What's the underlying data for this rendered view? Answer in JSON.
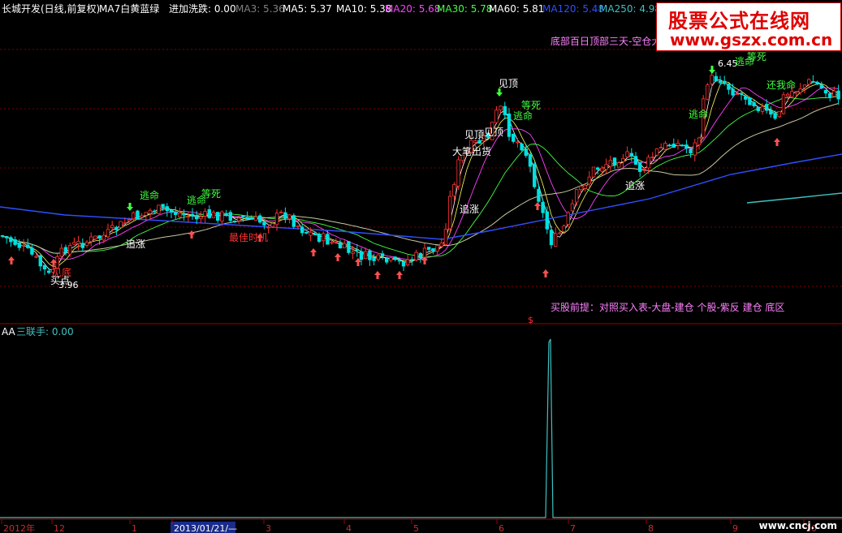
{
  "header": {
    "stock": "长城开发(日线,前复权)",
    "ma7_label": "MA7白黄蓝绿",
    "indicator_label": "进加洗跌: 0.00",
    "mas": [
      {
        "label": "MA3: 5.36",
        "color": "#808080"
      },
      {
        "label": "MA5: 5.37",
        "color": "#ffffff"
      },
      {
        "label": "MA10: 5.38",
        "color": "#ffffff"
      },
      {
        "label": "MA20: 5.68",
        "color": "#ff40ff"
      },
      {
        "label": "MA30: 5.78",
        "color": "#40ff40"
      },
      {
        "label": "MA60: 5.81",
        "color": "#ffffff"
      },
      {
        "label": "MA120: 5.48",
        "color": "#2f4fff"
      },
      {
        "label": "MA250: 4.98",
        "color": "#40c0c0"
      }
    ]
  },
  "annotations": {
    "top_right": "底部百日顶部三天-空仓大",
    "buy_hint": "买股前提：对照买入表-大盘-建仓  个股-紫反 建仓 底区",
    "low_price": "3.96",
    "high_price": "6.45",
    "signals": [
      {
        "text": "逃命",
        "color": "#40ff40",
        "pos": "a"
      },
      {
        "text": "逃命",
        "color": "#40ff40",
        "pos": "b"
      },
      {
        "text": "等死",
        "color": "#40ff40",
        "pos": "c"
      },
      {
        "text": "追涨",
        "color": "#ffffff",
        "pos": "d"
      },
      {
        "text": "最佳时机",
        "color": "#ff3030",
        "pos": "e"
      },
      {
        "text": "见底",
        "color": "#ff3030",
        "pos": "f"
      },
      {
        "text": "买点",
        "color": "#ffffff",
        "pos": "g"
      },
      {
        "text": "见顶",
        "color": "#ffffff",
        "pos": "h"
      },
      {
        "text": "见顶",
        "color": "#ffffff",
        "pos": "i"
      },
      {
        "text": "见顶",
        "color": "#ffffff",
        "pos": "j"
      },
      {
        "text": "大笔出货",
        "color": "#ffffff",
        "pos": "k"
      },
      {
        "text": "等死",
        "color": "#40ff40",
        "pos": "l"
      },
      {
        "text": "逃命",
        "color": "#40ff40",
        "pos": "m"
      },
      {
        "text": "追涨",
        "color": "#ffffff",
        "pos": "n"
      },
      {
        "text": "逃命",
        "color": "#40ff40",
        "pos": "o"
      },
      {
        "text": "追涨",
        "color": "#ffffff",
        "pos": "p"
      },
      {
        "text": "等死",
        "color": "#40ff40",
        "pos": "q"
      },
      {
        "text": "逃命",
        "color": "#40ff40",
        "pos": "r"
      },
      {
        "text": "还我命",
        "color": "#40ff40",
        "pos": "s"
      }
    ]
  },
  "sub_panel": {
    "name": "AA",
    "label": "三联手: 0.00",
    "label_color": "#40c0c0"
  },
  "x_axis": {
    "labels": [
      "2012年",
      "12",
      "1",
      "2013/01/21/—",
      "3",
      "4",
      "5",
      "6",
      "7",
      "8",
      "9",
      "10"
    ]
  },
  "watermarks": {
    "site_title": "股票公式在线网",
    "site_url": "www.gszx.com.cn",
    "corner": "www.cncj.com"
  },
  "colors": {
    "up": "#ff3232",
    "down": "#00e0e0",
    "grid": "#7a0000",
    "axis": "#a00000"
  }
}
